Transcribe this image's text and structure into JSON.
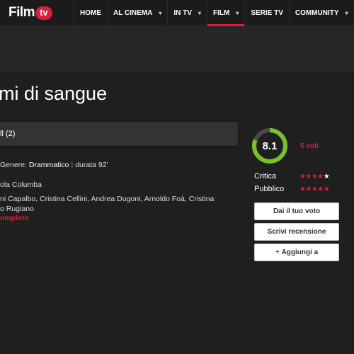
{
  "logo": {
    "film": "Film",
    "tv": "tv"
  },
  "nav": [
    {
      "label": "HOME",
      "dropdown": false,
      "active": false
    },
    {
      "label": "AL CINEMA",
      "dropdown": true,
      "active": false
    },
    {
      "label": "IN TV",
      "dropdown": true,
      "active": false
    },
    {
      "label": "FILM",
      "dropdown": true,
      "active": true
    },
    {
      "label": "SERIE TV",
      "dropdown": false,
      "active": false
    },
    {
      "label": "COMMUNITY",
      "dropdown": true,
      "active": false
    }
  ],
  "movie": {
    "title": "mi di sangue",
    "subbar_text": "ll (2)",
    "genre_label": "Genere:",
    "genre": "Drammatico",
    "duration": "durata 92'",
    "director": "ola Columba",
    "cast_line1": "ni Capalbo, Cristina Cellini, Andrea Dugoni, Arnoldo Foà, Cristina",
    "cast_line2": "o Rugiano",
    "full_cast_link": "ompleto"
  },
  "rating": {
    "score": "8.1",
    "score_fraction": 0.81,
    "votes": "5 voti",
    "critica_label": "Critica",
    "critica_stars": 4,
    "pubblico_label": "Pubblico",
    "pubblico_stars": 4.5
  },
  "buttons": {
    "rate": "Dai il tuo voto",
    "review": "Scrivi recensione",
    "add_plus": "+",
    "add": "Aggiungi a"
  },
  "colors": {
    "accent": "#d81e3c",
    "ring": "#7bbf2a"
  }
}
